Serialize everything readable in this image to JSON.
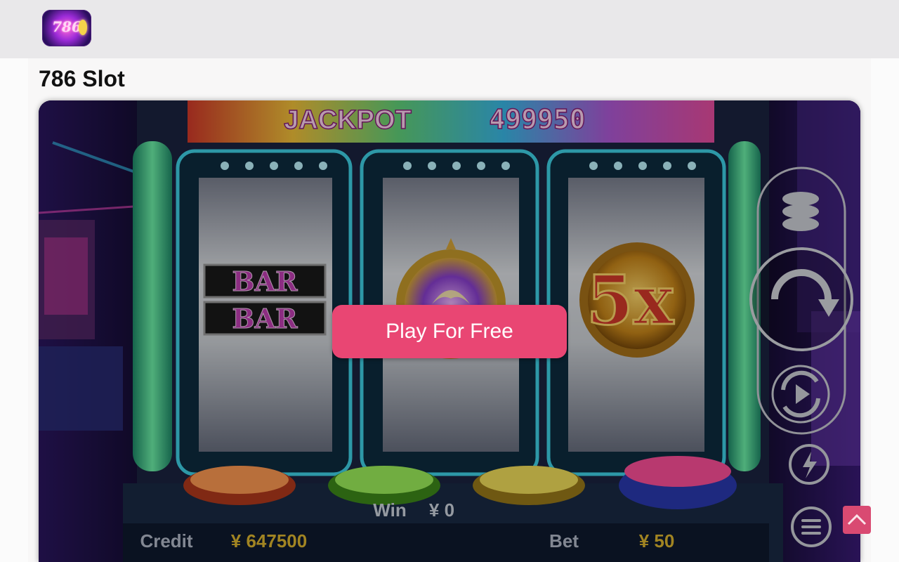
{
  "header": {
    "logo_text": "786",
    "logo_icon": "slot-logo-icon"
  },
  "page": {
    "title": "786 Slot"
  },
  "game": {
    "jackpot_label": "JACKPOT",
    "jackpot_value": "499950",
    "reels": [
      {
        "symbols": [
          "BAR",
          "BAR"
        ]
      },
      {
        "symbol_icon": "wing-medallion-icon"
      },
      {
        "symbol_text": "5x"
      }
    ],
    "win_label": "Win",
    "win_value": "¥ 0",
    "credit_label": "Credit",
    "credit_value": "¥ 647500",
    "bet_label": "Bet",
    "bet_value": "¥ 50",
    "controls": [
      {
        "icon": "coin-stack-icon"
      },
      {
        "icon": "spin-icon"
      },
      {
        "icon": "autoplay-icon"
      },
      {
        "icon": "lightning-icon"
      },
      {
        "icon": "menu-icon"
      }
    ],
    "play_button_label": "Play For Free",
    "colors": {
      "play_button": "#e94673",
      "scroll_top": "#d94a72",
      "topbar": "#e9e8ea"
    }
  },
  "scroll_top": {
    "icon": "chevron-up-icon"
  }
}
